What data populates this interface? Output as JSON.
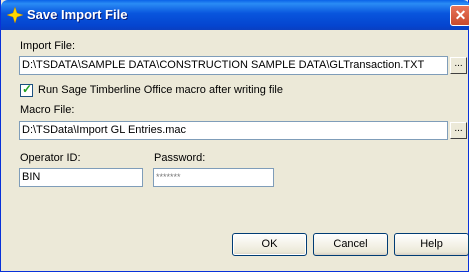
{
  "window": {
    "title": "Save Import File"
  },
  "import_file": {
    "label": "Import File:",
    "value": "D:\\TSDATA\\SAMPLE DATA\\CONSTRUCTION SAMPLE DATA\\GLTransaction.TXT",
    "browse": "..."
  },
  "run_macro": {
    "label": "Run Sage Timberline Office macro after writing file",
    "checked": true
  },
  "macro_file": {
    "label": "Macro File:",
    "value": "D:\\TSData\\Import GL Entries.mac",
    "browse": "..."
  },
  "operator_id": {
    "label": "Operator ID:",
    "value": "BIN"
  },
  "password": {
    "label": "Password:",
    "value": "*******"
  },
  "buttons": {
    "ok": "OK",
    "cancel": "Cancel",
    "help": "Help"
  }
}
